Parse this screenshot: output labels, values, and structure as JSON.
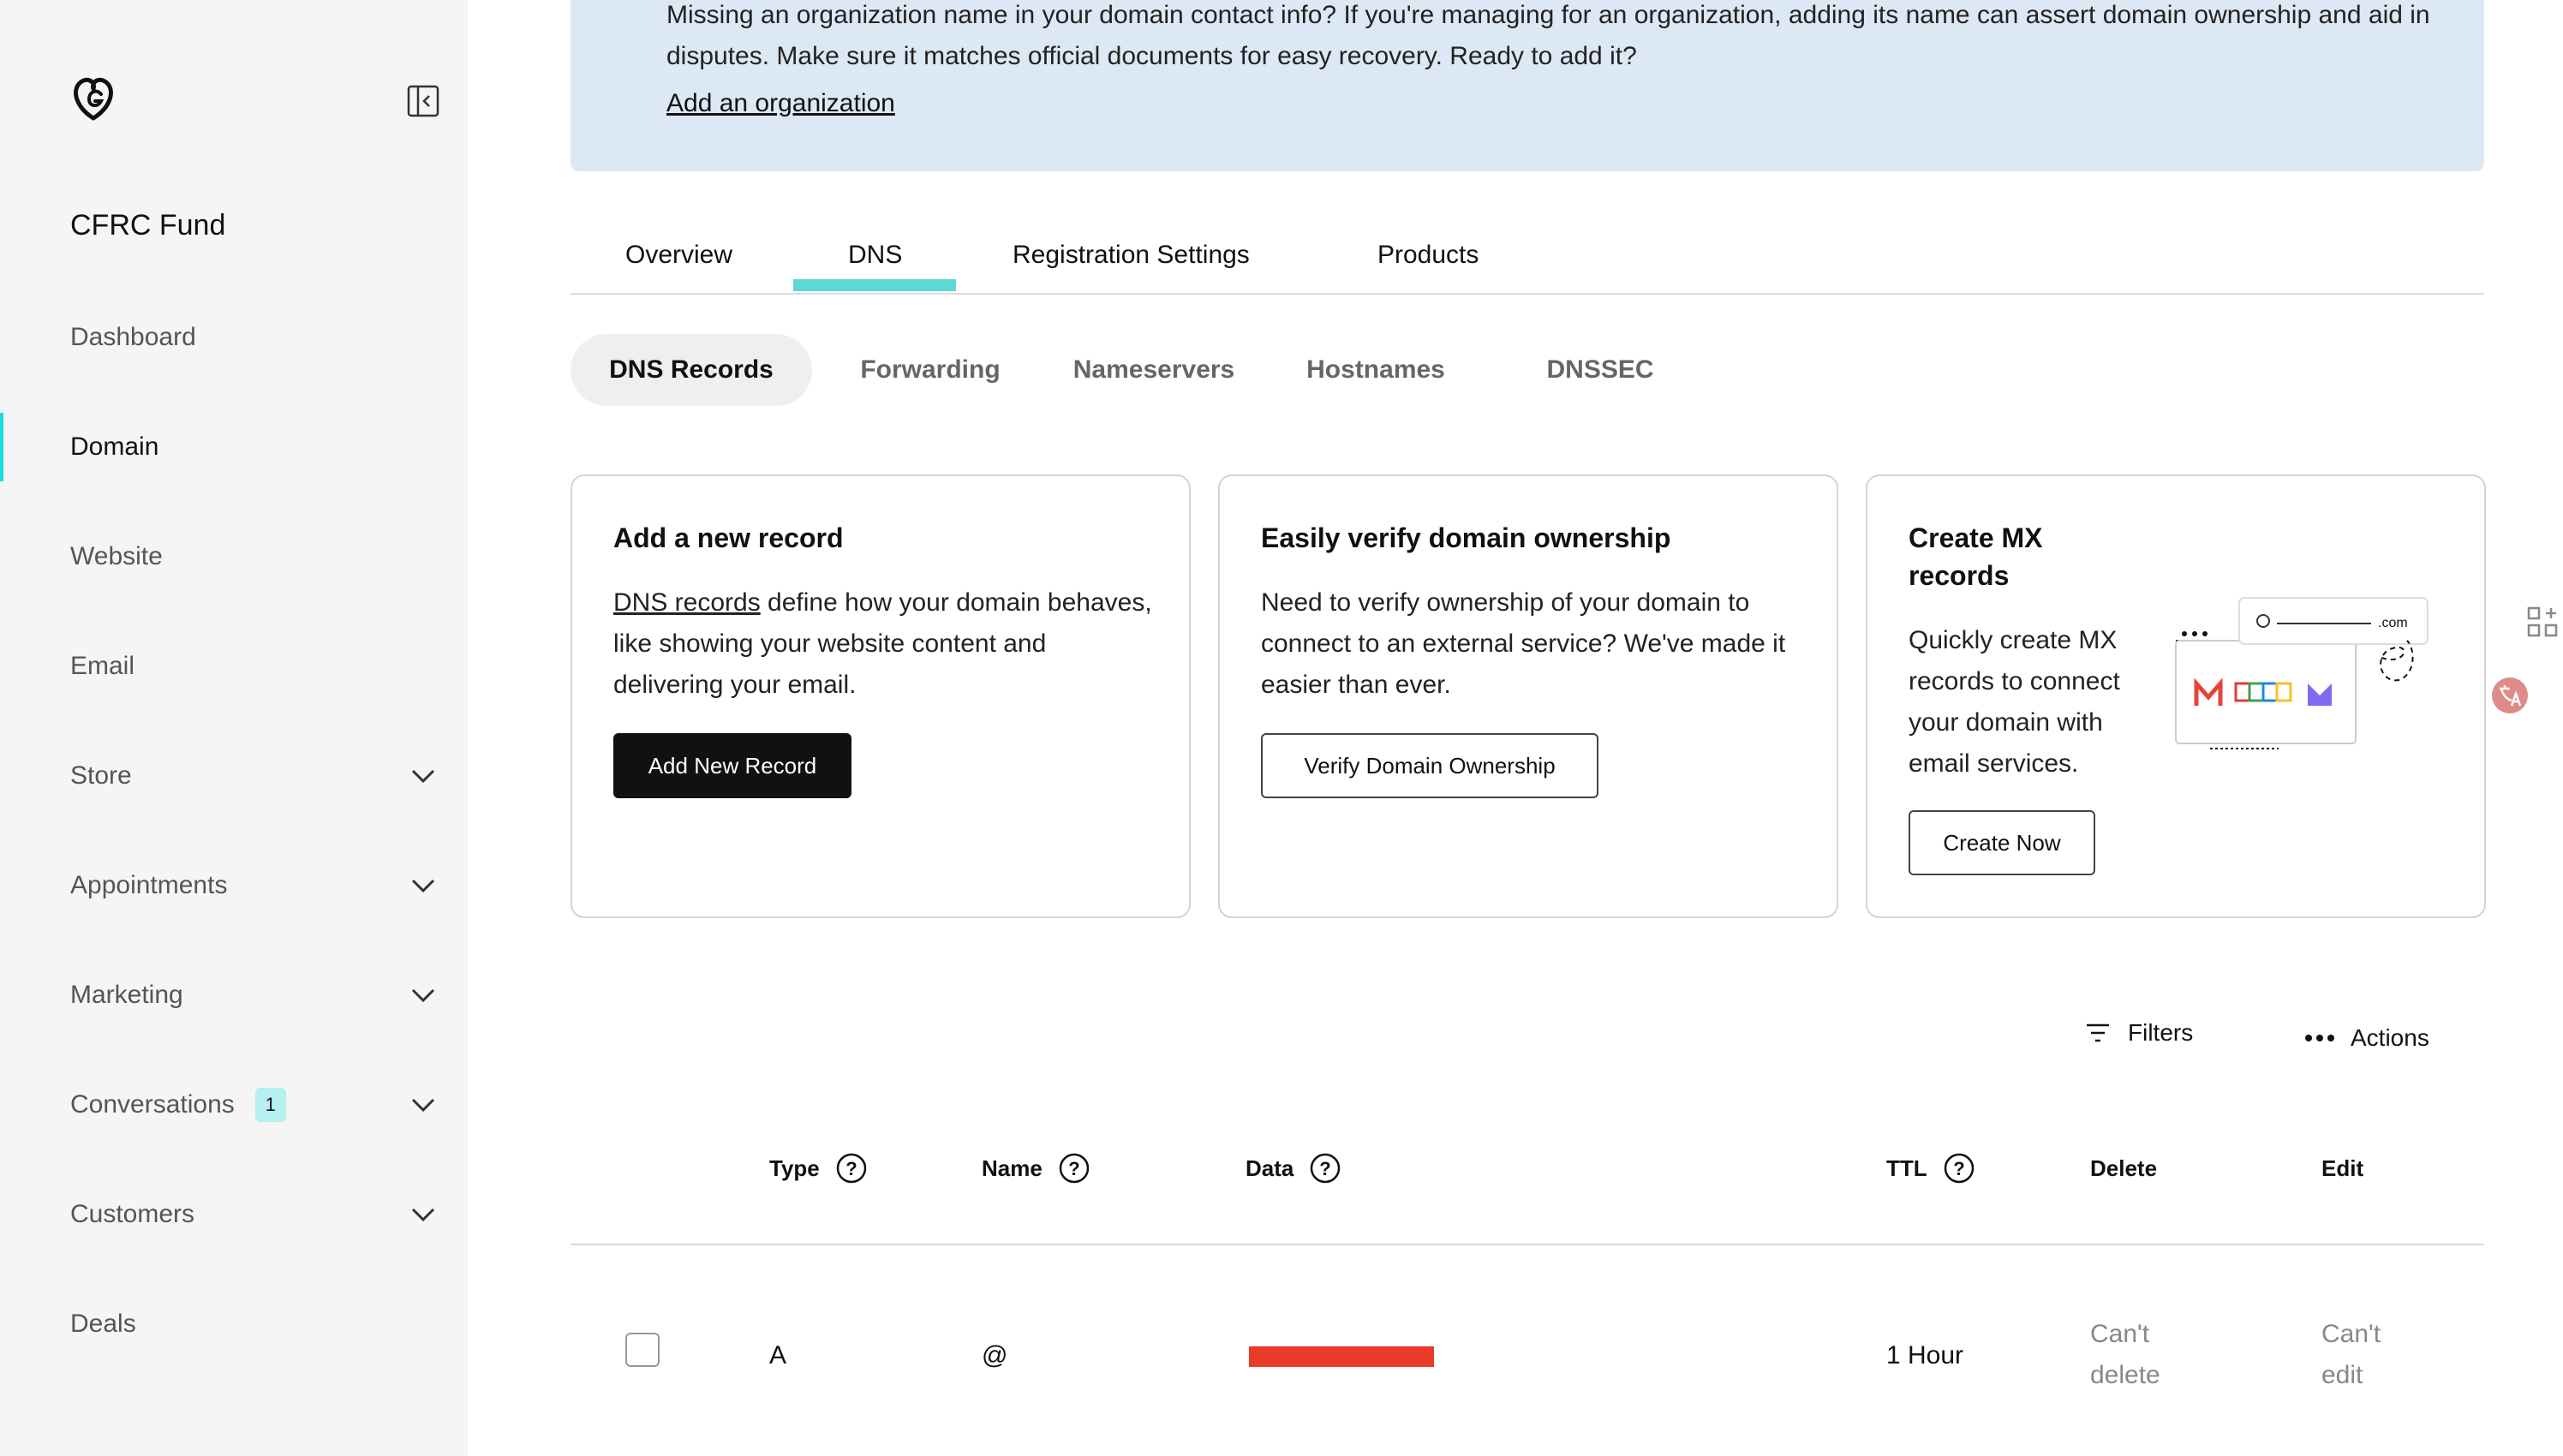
{
  "sidebar": {
    "account_name": "CFRC Fund",
    "items": [
      {
        "label": "Dashboard"
      },
      {
        "label": "Domain"
      },
      {
        "label": "Website"
      },
      {
        "label": "Email"
      },
      {
        "label": "Store"
      },
      {
        "label": "Appointments"
      },
      {
        "label": "Marketing"
      },
      {
        "label": "Conversations",
        "badge": "1"
      },
      {
        "label": "Customers"
      },
      {
        "label": "Deals"
      }
    ]
  },
  "banner": {
    "text": "Missing an organization name in your domain contact info? If you're managing for an organization, adding its name can assert domain ownership and aid in disputes. Make sure it matches official documents for easy recovery. Ready to add it?",
    "link": "Add an organization"
  },
  "tabs": [
    "Overview",
    "DNS",
    "Registration Settings",
    "Products"
  ],
  "subtabs": [
    "DNS Records",
    "Forwarding",
    "Nameservers",
    "Hostnames",
    "DNSSEC"
  ],
  "cards": {
    "new_record": {
      "title": "Add a new record",
      "link": "DNS records",
      "body": " define how your domain behaves, like showing your website content and delivering your email.",
      "button": "Add New Record"
    },
    "verify": {
      "title": "Easily verify domain ownership",
      "body": "Need to verify ownership of your domain to connect to an external service? We've made it easier than ever.",
      "button": "Verify Domain Ownership"
    },
    "mx": {
      "title": "Create MX records",
      "body": "Quickly create MX records to connect your domain with email services.",
      "button": "Create Now",
      "illustration_domain": ".com"
    }
  },
  "toolbar": {
    "filters": "Filters",
    "actions": "Actions"
  },
  "table": {
    "headers": {
      "type": "Type",
      "name": "Name",
      "data": "Data",
      "ttl": "TTL",
      "delete": "Delete",
      "edit": "Edit"
    },
    "rows": [
      {
        "type": "A",
        "name": "@",
        "data": "[redacted]",
        "ttl": "1 Hour",
        "delete": "Can't delete",
        "edit": "Can't edit"
      }
    ]
  },
  "colors": {
    "accent": "#5ed7d7",
    "banner_bg": "#dde8f5",
    "redaction": "#ea3a2a"
  }
}
